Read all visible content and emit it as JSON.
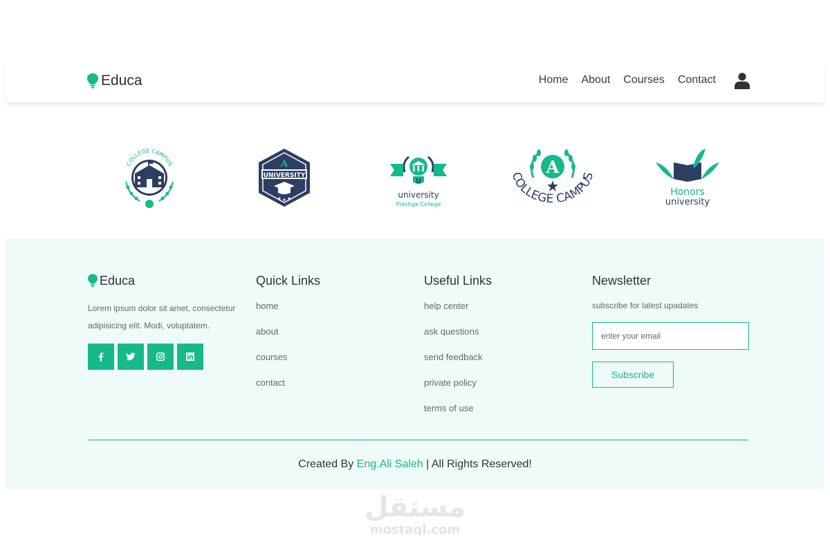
{
  "brand": {
    "name": "Educa"
  },
  "nav": {
    "items": [
      "Home",
      "About",
      "Courses",
      "Contact"
    ]
  },
  "logos": [
    {
      "top_text": "COLLEGE CAMPUS"
    },
    {
      "letter": "A",
      "text": "UNIVERSITY"
    },
    {
      "letter": "U",
      "name": "university",
      "subtitle": "Prestige College"
    },
    {
      "letter": "A",
      "text": "COLLEGE CAMPUS"
    },
    {
      "line1": "Honors",
      "line2": "university"
    }
  ],
  "footer": {
    "brand": "Educa",
    "description": "Lorem ipsum dolor sit amet, consectetur adipisicing elit. Modi, voluptatem.",
    "quick_links": {
      "title": "Quick Links",
      "items": [
        "home",
        "about",
        "courses",
        "contact"
      ]
    },
    "useful_links": {
      "title": "Useful Links",
      "items": [
        "help center",
        "ask questions",
        "send feedback",
        "private policy",
        "terms of use"
      ]
    },
    "newsletter": {
      "title": "Newsletter",
      "subtitle": "subscribe for latest upadates",
      "placeholder": "enter your email",
      "button": "Subscribe"
    },
    "copyright": {
      "prefix": "Created By ",
      "author": "Eng.Ali Saleh",
      "suffix": " | All Rights Reserved!"
    }
  },
  "watermark": {
    "arabic": "مستقل",
    "latin": "mostaql.com"
  },
  "colors": {
    "accent": "#16b98a",
    "footer_bg": "#effbf8",
    "navy": "#2d3e63"
  },
  "icons": [
    "lightbulb-icon",
    "user-icon",
    "facebook-icon",
    "twitter-icon",
    "instagram-icon",
    "linkedin-icon"
  ]
}
